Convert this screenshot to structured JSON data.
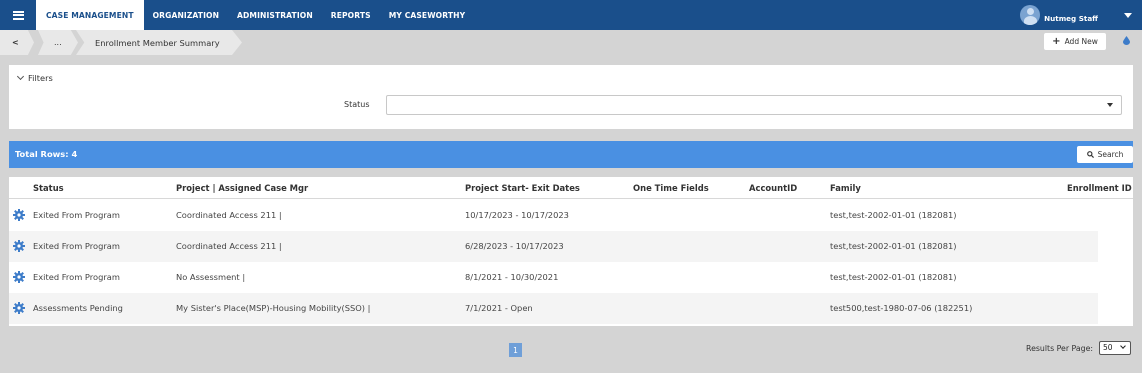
{
  "nav": {
    "items": [
      "CASE MANAGEMENT",
      "ORGANIZATION",
      "ADMINISTRATION",
      "REPORTS",
      "MY CASEWORTHY"
    ],
    "user_name": "Nutmeg Staff"
  },
  "breadcrumb": {
    "back": "<",
    "ellipsis": "...",
    "title": "Enrollment Member Summary"
  },
  "toolbar": {
    "add_new_label": "Add New"
  },
  "filters": {
    "heading": "Filters",
    "status_label": "Status",
    "status_value": ""
  },
  "results": {
    "total_label": "Total Rows: 4",
    "search_label": "Search"
  },
  "table": {
    "headers": [
      "Status",
      "Project | Assigned Case Mgr",
      "Project Start- Exit Dates",
      "One Time Fields",
      "AccountID",
      "Family",
      "Enrollment ID"
    ],
    "rows": [
      {
        "status": "Exited From Program",
        "project": "Coordinated Access 211 |",
        "dates": "10/17/2023 - 10/17/2023",
        "family": "test,test-2002-01-01 (182081)"
      },
      {
        "status": "Exited From Program",
        "project": "Coordinated Access 211 |",
        "dates": "6/28/2023 - 10/17/2023",
        "family": "test,test-2002-01-01 (182081)"
      },
      {
        "status": "Exited From Program",
        "project": "No Assessment |",
        "dates": "8/1/2021 - 10/30/2021",
        "family": "test,test-2002-01-01 (182081)"
      },
      {
        "status": "Assessments Pending",
        "project": "My Sister's Place(MSP)-Housing Mobility(SSO) |",
        "dates": "7/1/2021 - Open",
        "family": "test500,test-1980-07-06 (182251)"
      }
    ]
  },
  "pager": {
    "current_page": "1",
    "results_per_page_label": "Results Per Page:",
    "results_per_page_value": "50"
  },
  "colors": {
    "nav": "#1a4f8b",
    "total_bar": "#4a90e2",
    "gear": "#3d7cc9"
  }
}
